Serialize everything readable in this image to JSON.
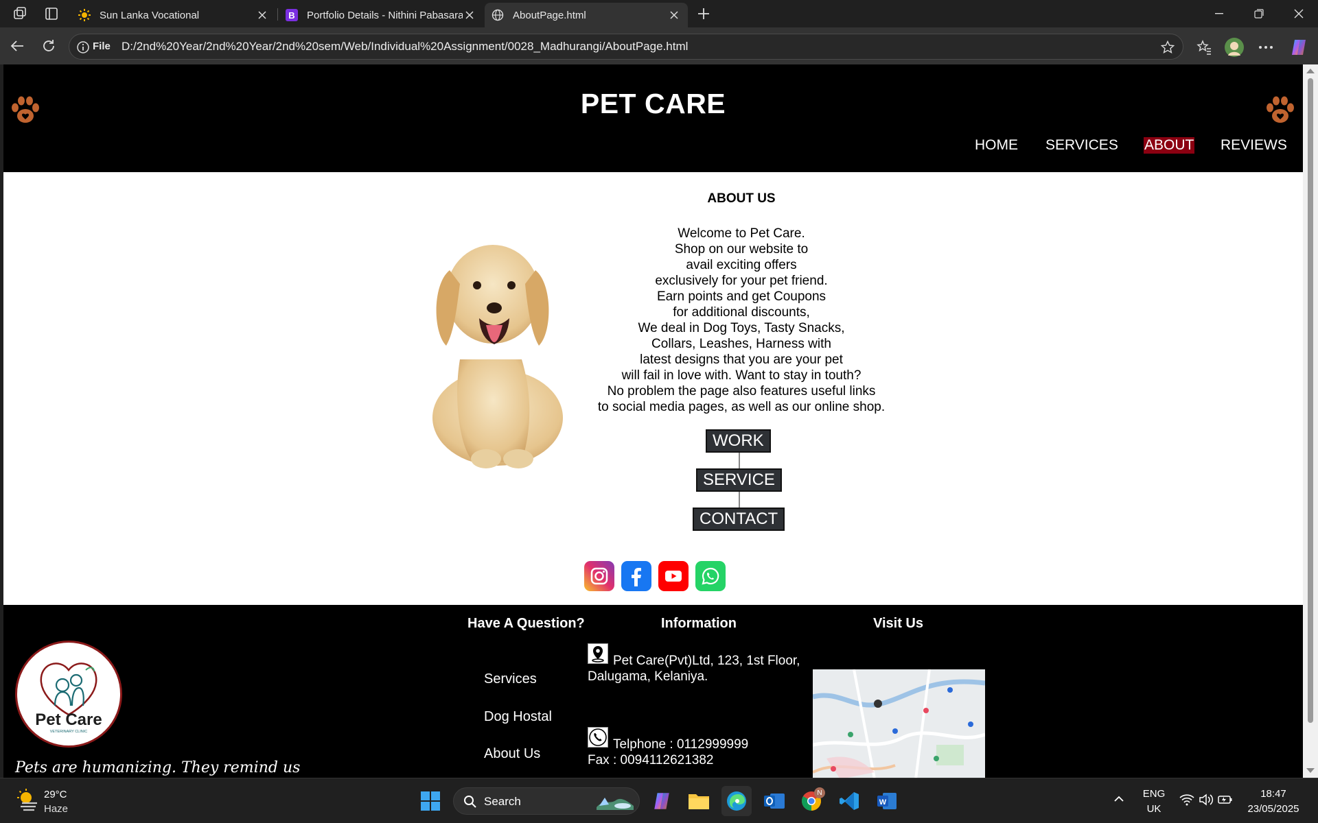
{
  "browser": {
    "tabs": [
      {
        "title": "Sun Lanka Vocational",
        "active": false
      },
      {
        "title": "Portfolio Details - Nithini Pabasara",
        "active": false
      },
      {
        "title": "AboutPage.html",
        "active": true
      }
    ],
    "address_label": "File",
    "url": "D:/2nd%20Year/2nd%20Year/2nd%20sem/Web/Individual%20Assignment/0028_Madhurangi/AboutPage.html"
  },
  "site": {
    "title": "PET CARE",
    "menu": [
      "HOME",
      "SERVICES",
      "ABOUT",
      "REVIEWS"
    ],
    "active_menu": "ABOUT",
    "about": {
      "heading": "ABOUT US",
      "lines": [
        "Welcome to Pet Care.",
        "Shop on our website to",
        "avail exciting offers",
        "exclusively for your pet friend.",
        "Earn points and get Coupons",
        "for additional discounts,",
        "We deal in Dog Toys, Tasty Snacks,",
        "Collars, Leashes, Harness with",
        "latest designs that you are your pet",
        "will fail in love with. Want to stay in touth?",
        "No problem the page also features useful links",
        "to social media pages, as well as our online shop."
      ],
      "buttons": [
        "WORK",
        "SERVICE",
        "CONTACT"
      ]
    },
    "social": [
      "instagram-icon",
      "facebook-icon",
      "youtube-icon",
      "whatsapp-icon"
    ],
    "footer": {
      "question_heading": "Have A Question?",
      "information_heading": "Information",
      "visit_heading": "Visit Us",
      "links": [
        "Services",
        "Dog Hostal",
        "About Us"
      ],
      "address_lines": [
        "Pet Care(Pvt)Ltd, 123, 1st Floor,",
        "Dalugama, Kelaniya."
      ],
      "phone": "Telphone : 0112999999",
      "fax": "Fax : 0094112621382",
      "logo_text": "Pet Care",
      "logo_subtext": "VETERINARY CLINIC",
      "tagline": "Pets are humanizing. They remind us"
    }
  },
  "taskbar": {
    "weather_temp": "29°C",
    "weather_desc": "Haze",
    "search_placeholder": "Search",
    "lang_top": "ENG",
    "lang_bottom": "UK",
    "time": "18:47",
    "date": "23/05/2025",
    "chrome_badge": "N"
  },
  "colors": {
    "header_bg": "#000000",
    "active_menu_bg": "#8b0011",
    "paw": "#c0632f",
    "button_bg": "#2e3135"
  }
}
